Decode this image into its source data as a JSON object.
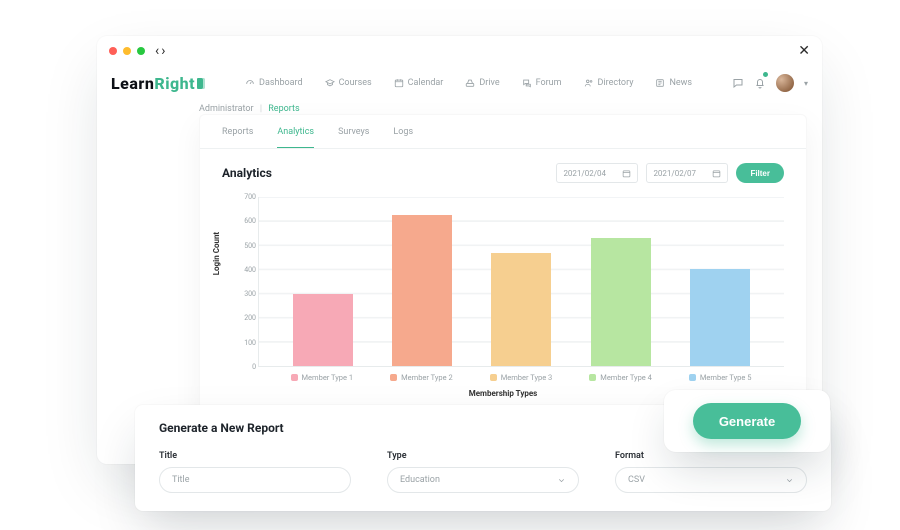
{
  "brand": {
    "left": "Learn",
    "right": "Right"
  },
  "window_nav": {
    "back": "‹",
    "forward": "›"
  },
  "nav": {
    "items": [
      {
        "label": "Dashboard"
      },
      {
        "label": "Courses"
      },
      {
        "label": "Calendar"
      },
      {
        "label": "Drive"
      },
      {
        "label": "Forum"
      },
      {
        "label": "Directory"
      },
      {
        "label": "News"
      }
    ]
  },
  "breadcrumb": {
    "a": "Administrator",
    "b": "Reports"
  },
  "tabs": {
    "items": [
      "Reports",
      "Analytics",
      "Surveys",
      "Logs"
    ],
    "active": 1
  },
  "analytics": {
    "title": "Analytics",
    "date_from": "2021/02/04",
    "date_to": "2021/02/07",
    "filter_label": "Filter"
  },
  "chart_data": {
    "type": "bar",
    "title": "",
    "xlabel": "Membership Types",
    "ylabel": "Login Count",
    "ylim": [
      0,
      700
    ],
    "categories": [
      "Member Type 1",
      "Member Type 2",
      "Member Type 3",
      "Member Type 4",
      "Member Type 5"
    ],
    "values": [
      300,
      625,
      470,
      530,
      400
    ],
    "colors": [
      "#f7a9b6",
      "#f6a98d",
      "#f6cf90",
      "#b7e6a1",
      "#9fd2f0"
    ],
    "yticks": [
      0,
      100,
      200,
      300,
      400,
      500,
      600,
      700
    ]
  },
  "report": {
    "heading": "Generate a New Report",
    "fields": {
      "title": {
        "label": "Title",
        "placeholder": "Title"
      },
      "type": {
        "label": "Type",
        "value": "Education"
      },
      "format": {
        "label": "Format",
        "value": "CSV"
      }
    }
  },
  "generate": {
    "label": "Generate"
  }
}
